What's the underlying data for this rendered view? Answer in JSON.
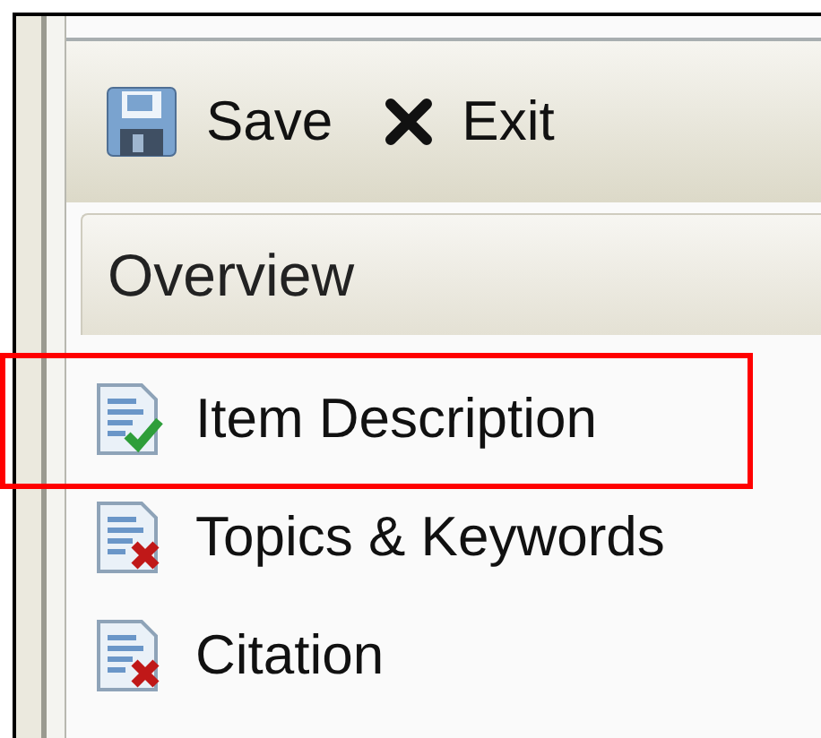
{
  "toolbar": [
    {
      "kind": "save",
      "label": "Save"
    },
    {
      "kind": "exit",
      "label": "Exit"
    }
  ],
  "section": {
    "title": "Overview"
  },
  "items": [
    {
      "label": "Item Description",
      "complete": true,
      "highlighted": true
    },
    {
      "label": "Topics & Keywords",
      "complete": false,
      "highlighted": false
    },
    {
      "label": "Citation",
      "complete": false,
      "highlighted": false
    }
  ]
}
